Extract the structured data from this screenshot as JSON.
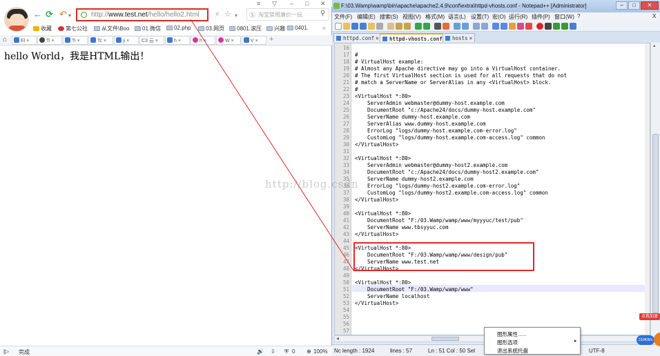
{
  "browser": {
    "address_protocol": "http://",
    "address_domain": "www.test.net",
    "address_path": "/hello/hello2.html",
    "search_placeholder": "淘宝禁用廉价一玩",
    "bookmarks": [
      "收藏",
      "第七公社",
      "从文件\\Boo",
      "01.微信",
      "02.php",
      "03.网页",
      "0801.滚压",
      "兴趣",
      "0401."
    ],
    "tabs": [
      "El",
      "Ti",
      "Ti",
      "Tc",
      "ji",
      "C3 云",
      "h",
      "h",
      "W",
      "V"
    ],
    "content_text": "hello World，我是HTML输出！",
    "status_text": "完成",
    "zoom": "100%",
    "status_badge": "0"
  },
  "npp": {
    "title": "F:\\03.Wamp\\wamp\\bin\\apache\\apache2.4.9\\conf\\extra\\httpd-vhosts.conf - Notepad++ [Administrator]",
    "menu": [
      "文件(F)",
      "编辑(E)",
      "搜索(S)",
      "视图(V)",
      "格式(M)",
      "语言(L)",
      "设置(T)",
      "宏(O)",
      "运行(R)",
      "插件(P)",
      "窗口(W)",
      "?"
    ],
    "menu_close": "X",
    "tabs": [
      "httpd.conf",
      "httpd-vhosts.conf",
      "hosts"
    ],
    "lines": [
      {
        "n": "16",
        "t": ""
      },
      {
        "n": "17",
        "t": "#"
      },
      {
        "n": "18",
        "t": "# VirtualHost example:"
      },
      {
        "n": "19",
        "t": "# Almost any Apache directive may go into a VirtualHost container."
      },
      {
        "n": "20",
        "t": "# The first VirtualHost section is used for all requests that do not"
      },
      {
        "n": "21",
        "t": "# match a ServerName or ServerAlias in any <VirtualHost> block."
      },
      {
        "n": "22",
        "t": "#"
      },
      {
        "n": "23",
        "t": "<VirtualHost *:80>"
      },
      {
        "n": "24",
        "t": "    ServerAdmin webmaster@dummy-host.example.com"
      },
      {
        "n": "25",
        "t": "    DocumentRoot \"c:/Apache24/docs/dummy-host.example.com\""
      },
      {
        "n": "26",
        "t": "    ServerName dummy-host.example.com"
      },
      {
        "n": "27",
        "t": "    ServerAlias www.dummy-host.example.com"
      },
      {
        "n": "28",
        "t": "    ErrorLog \"logs/dummy-host.example.com-error.log\""
      },
      {
        "n": "29",
        "t": "    CustomLog \"logs/dummy-host.example.com-access.log\" common"
      },
      {
        "n": "30",
        "t": "</VirtualHost>"
      },
      {
        "n": "31",
        "t": ""
      },
      {
        "n": "32",
        "t": "<VirtualHost *:80>"
      },
      {
        "n": "33",
        "t": "    ServerAdmin webmaster@dummy-host2.example.com"
      },
      {
        "n": "34",
        "t": "    DocumentRoot \"c:/Apache24/docs/dummy-host2.example.com\""
      },
      {
        "n": "35",
        "t": "    ServerName dummy-host2.example.com"
      },
      {
        "n": "36",
        "t": "    ErrorLog \"logs/dummy-host2.example.com-error.log\""
      },
      {
        "n": "37",
        "t": "    CustomLog \"logs/dummy-host2.example.com-access.log\" common"
      },
      {
        "n": "38",
        "t": "</VirtualHost>"
      },
      {
        "n": "39",
        "t": ""
      },
      {
        "n": "40",
        "t": "<VirtualHost *:80>"
      },
      {
        "n": "41",
        "t": "    DocumentRoot \"F:/03.Wamp/wamp/www/myyyuc/test/pub\""
      },
      {
        "n": "42",
        "t": "    ServerName www.tbsyyuc.com"
      },
      {
        "n": "43",
        "t": "</VirtualHost>"
      },
      {
        "n": "44",
        "t": ""
      },
      {
        "n": "45",
        "t": "<VirtualHost *:80>"
      },
      {
        "n": "46",
        "t": "    DocumentRoot \"F:/03.Wamp/wamp/www/design/pub\""
      },
      {
        "n": "47",
        "t": "    ServerName www.test.net"
      },
      {
        "n": "48",
        "t": "</VirtualHost>"
      },
      {
        "n": "49",
        "t": ""
      },
      {
        "n": "50",
        "t": "<VirtualHost *:80>"
      },
      {
        "n": "51",
        "t": "    DocumentRoot \"F:/03.Wamp/wamp/www\""
      },
      {
        "n": "52",
        "t": "    ServerName localhost"
      },
      {
        "n": "53",
        "t": "</VirtualHost>"
      },
      {
        "n": "54",
        "t": ""
      },
      {
        "n": "55",
        "t": ""
      },
      {
        "n": "56",
        "t": ""
      },
      {
        "n": "57",
        "t": ""
      }
    ],
    "status": {
      "length": "Nc length : 1924",
      "lines": "lines : 57",
      "position": "Ln : 51   Col : 50   Sel",
      "encoding": "UTF-8"
    }
  },
  "context_menu": [
    "图形属性......",
    "图形选项",
    "退出系统托盘"
  ],
  "watermark": "http://blog.csdn",
  "corner_badge": "150KB/s",
  "corner_label": "点我加速"
}
